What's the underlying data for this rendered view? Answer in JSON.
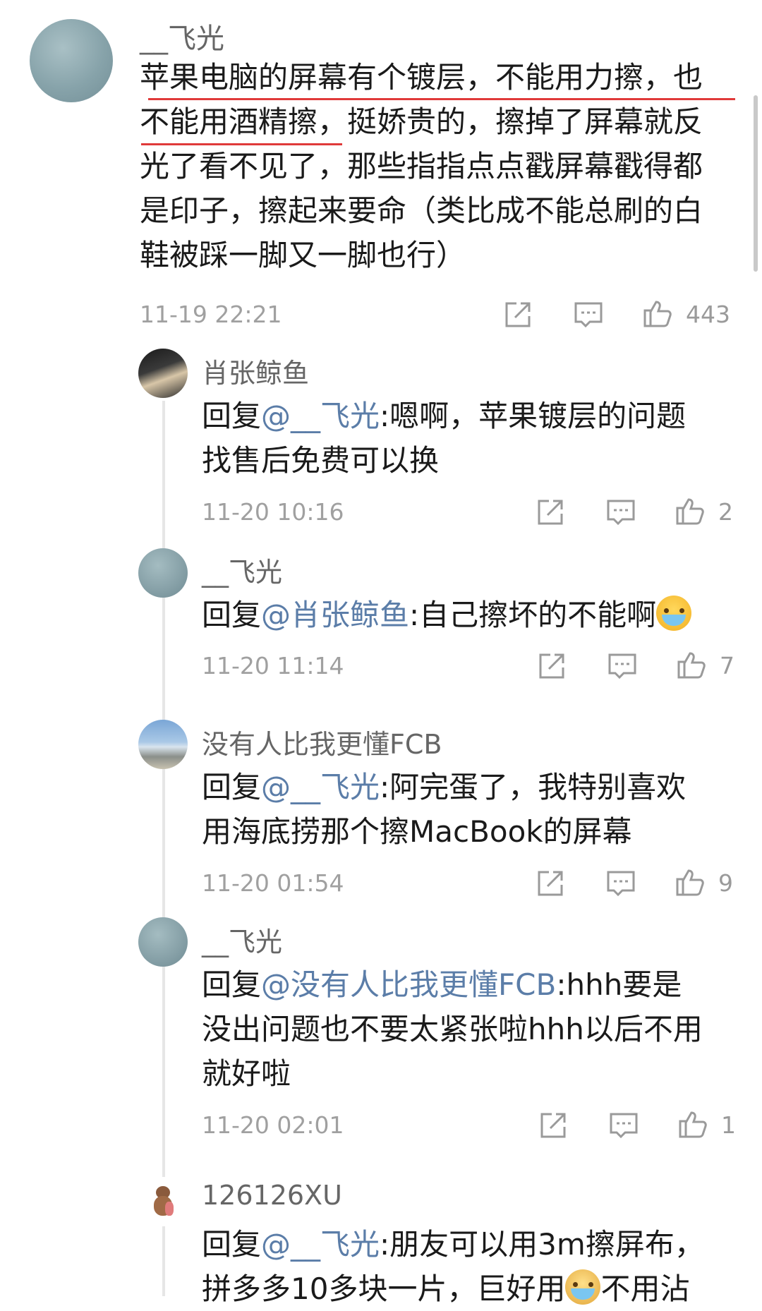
{
  "main_comment": {
    "username": "__飞光",
    "text_line1": "苹果电脑的屏幕有个镀层，不能用力擦，也",
    "text_line2": "不能用酒精擦，挺娇贵的，擦掉了屏幕就反",
    "text_line3": "光了看不见了，那些指指点点戳屏幕戳得都",
    "text_line4": "是印子，擦起来要命（类比成不能总刷的白",
    "text_line5": "鞋被踩一脚又一脚也行）",
    "time": "11-19 22:21",
    "likes": "443",
    "underline_color": "#e03a3a"
  },
  "replies": [
    {
      "username": "肖张鲸鱼",
      "prefix": "回复",
      "mention": "@__飞光",
      "text_line1": ":嗯啊，苹果镀层的问题",
      "text_line2": "找售后免费可以换",
      "time": "11-20 10:16",
      "likes": "2"
    },
    {
      "username": "__飞光",
      "prefix": "回复",
      "mention": "@肖张鲸鱼",
      "text_line1": ":自己擦坏的不能啊",
      "emoji": "crying-face-emoji",
      "time": "11-20 11:14",
      "likes": "7"
    },
    {
      "username": "没有人比我更懂FCB",
      "prefix": "回复",
      "mention": "@__飞光",
      "text_line1": ":阿完蛋了，我特别喜欢",
      "text_line2": "用海底捞那个擦MacBook的屏幕",
      "time": "11-20 01:54",
      "likes": "9"
    },
    {
      "username": "__飞光",
      "prefix": "回复",
      "mention": "@没有人比我更懂FCB",
      "text_line1": ":hhh要是",
      "text_line2": "没出问题也不要太紧张啦hhh以后不用",
      "text_line3": "就好啦",
      "time": "11-20 02:01",
      "likes": "1"
    },
    {
      "username": "126126XU",
      "prefix": "回复",
      "mention": "@__飞光",
      "text_line1": ":朋友可以用3m擦屏布，",
      "text_line2_partial": "拼多多10多块一片，巨好用",
      "text_line2_tail": "不用沾"
    }
  ],
  "colors": {
    "mention": "#5b7da8",
    "meta": "#a0a0a0",
    "text": "#1a1a1a"
  }
}
